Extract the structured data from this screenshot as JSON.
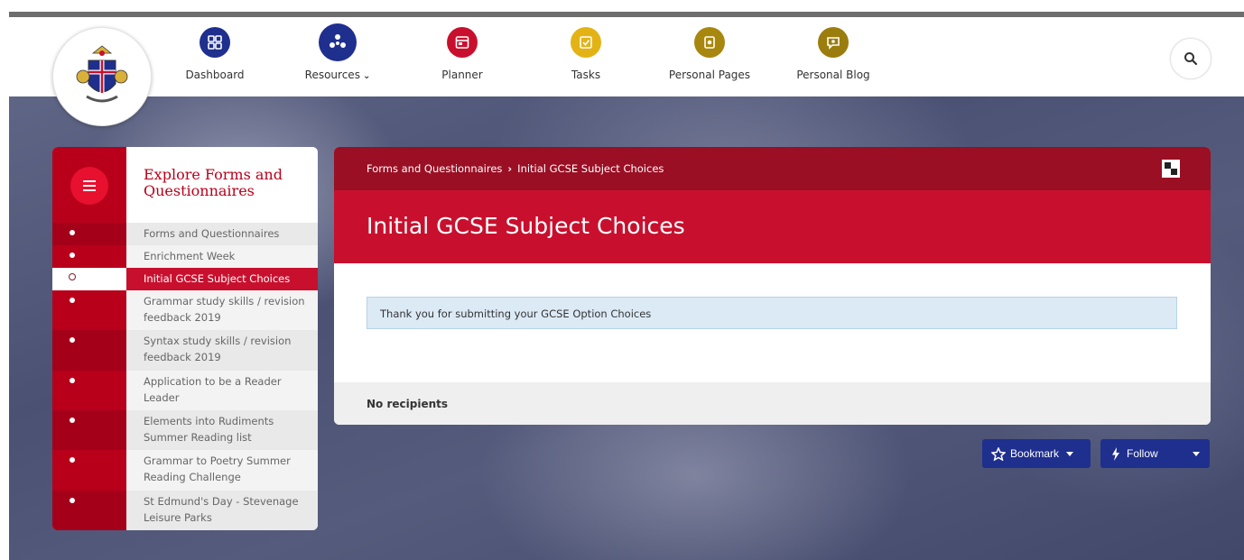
{
  "nav": {
    "items": [
      {
        "label": "Dashboard",
        "icon": "dashboard-icon",
        "color": "#1f2f8e"
      },
      {
        "label": "Resources",
        "icon": "resources-icon",
        "color": "#1f2f8e"
      },
      {
        "label": "Planner",
        "icon": "planner-icon",
        "color": "#c8102e"
      },
      {
        "label": "Tasks",
        "icon": "tasks-icon",
        "color": "#e3b316"
      },
      {
        "label": "Personal Pages",
        "icon": "personal-pages-icon",
        "color": "#a8870f"
      },
      {
        "label": "Personal Blog",
        "icon": "personal-blog-icon",
        "color": "#9a7d0c"
      }
    ],
    "search_icon": "search-icon"
  },
  "sidebar": {
    "title": "Explore Forms and Questionnaires",
    "items": [
      {
        "label": "Forms and Questionnaires"
      },
      {
        "label": "Enrichment Week"
      },
      {
        "label": "Initial GCSE Subject Choices"
      },
      {
        "label": "Grammar study skills / revision feedback 2019"
      },
      {
        "label": "Syntax study skills / revision feedback 2019"
      },
      {
        "label": "Application to be a Reader Leader"
      },
      {
        "label": "Elements into Rudiments Summer Reading list"
      },
      {
        "label": "Grammar to Poetry Summer Reading Challenge"
      },
      {
        "label": "St Edmund's Day - Stevenage Leisure Parks"
      }
    ]
  },
  "main": {
    "breadcrumb": {
      "parent": "Forms and Questionnaires",
      "current": "Initial GCSE Subject Choices"
    },
    "title": "Initial GCSE Subject Choices",
    "alert": "Thank you for submitting your GCSE Option Choices",
    "recipients": "No recipients"
  },
  "actions": {
    "bookmark": "Bookmark",
    "follow": "Follow"
  },
  "colors": {
    "brand_red": "#c8102e",
    "dark_red": "#9a0f24",
    "navy": "#1f2f8e"
  }
}
